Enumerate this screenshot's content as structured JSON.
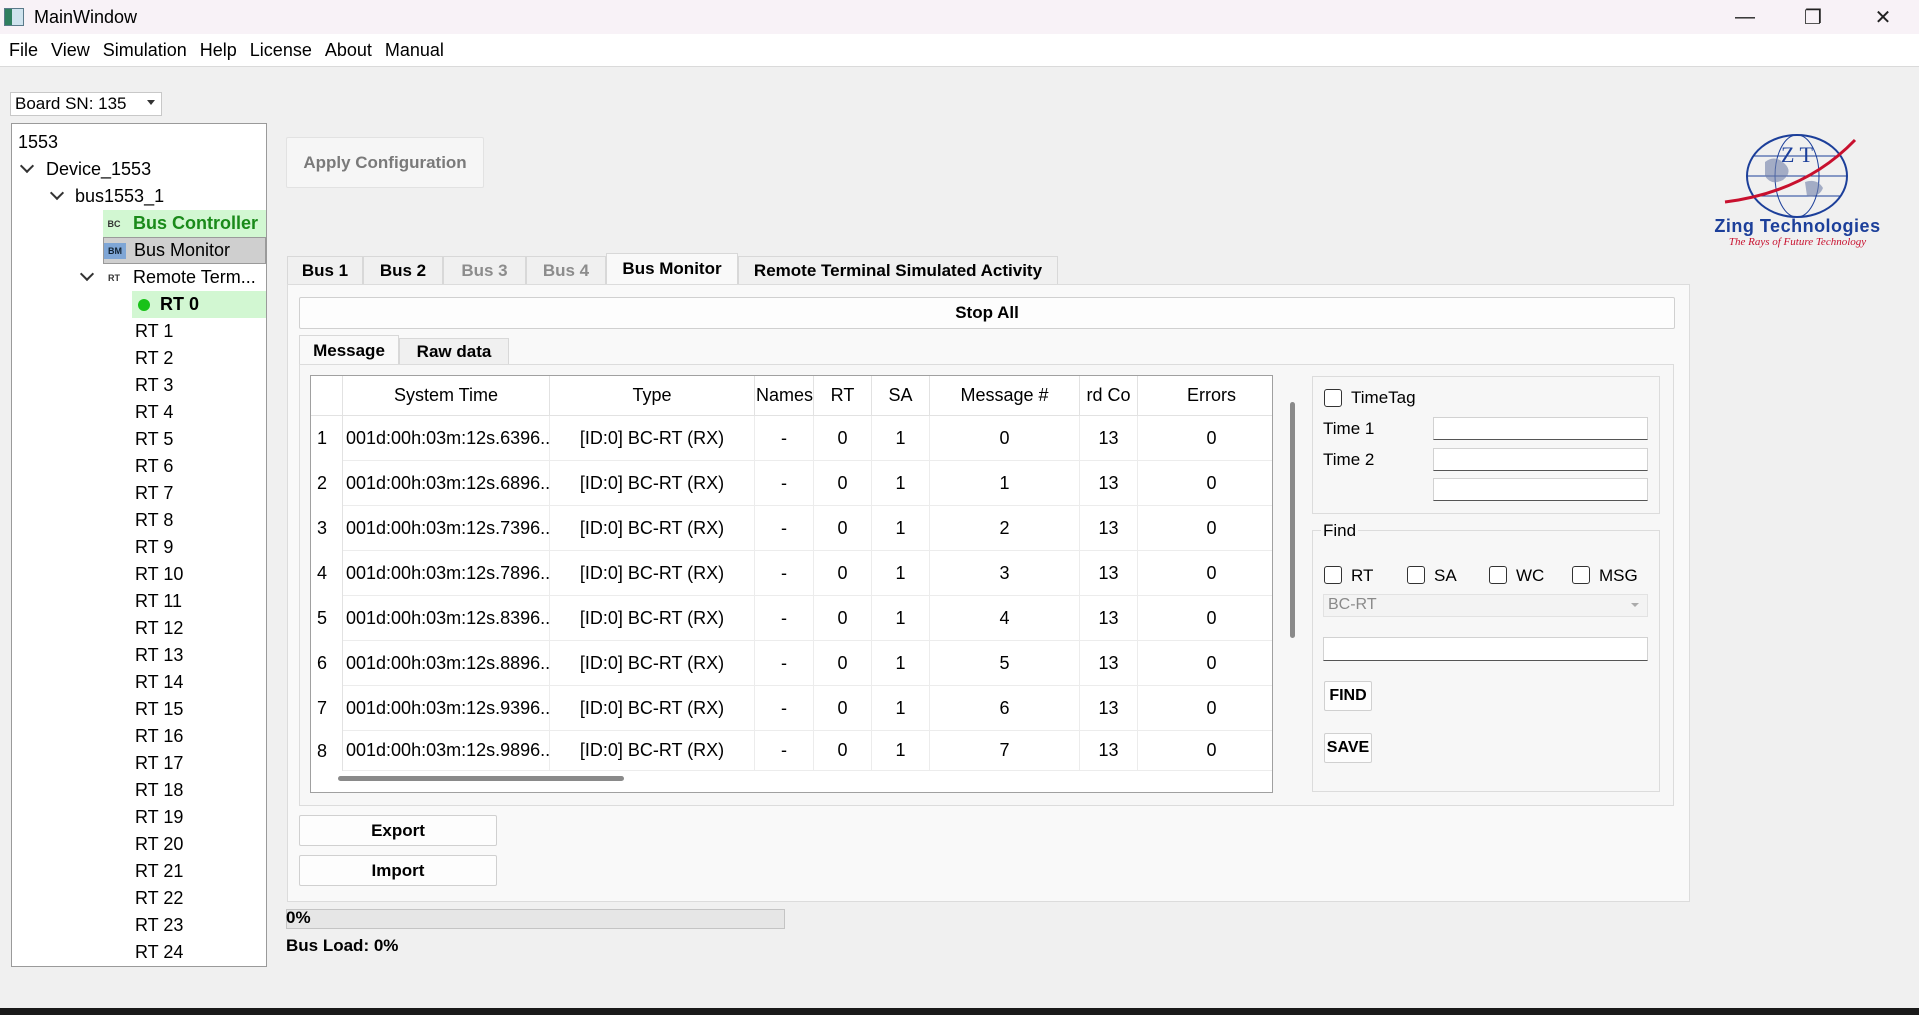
{
  "window": {
    "title": "MainWindow",
    "minimize_glyph": "—",
    "maximize_glyph": "❐",
    "close_glyph": "✕"
  },
  "menu": [
    "File",
    "View",
    "Simulation",
    "Help",
    "License",
    "About",
    "Manual"
  ],
  "board": {
    "label": "Board SN: 135"
  },
  "tree": {
    "root": "1553",
    "device": "Device_1553",
    "bus": "bus1553_1",
    "bc": {
      "tag": "BC",
      "label": "Bus Controller"
    },
    "bm": {
      "tag": "BM",
      "label": "Bus Monitor"
    },
    "rt": {
      "tag": "RT",
      "label": "Remote Term..."
    },
    "rt_items": [
      "RT 0",
      "RT 1",
      "RT 2",
      "RT 3",
      "RT 4",
      "RT 5",
      "RT 6",
      "RT 7",
      "RT 8",
      "RT 9",
      "RT 10",
      "RT 11",
      "RT 12",
      "RT 13",
      "RT 14",
      "RT 15",
      "RT 16",
      "RT 17",
      "RT 18",
      "RT 19",
      "RT 20",
      "RT 21",
      "RT 22",
      "RT 23",
      "RT 24"
    ]
  },
  "apply_button": "Apply Configuration",
  "logo": {
    "company": "Zing Technologies",
    "tagline": "The Rays of Future Technology",
    "mark": "Z T"
  },
  "tabs": [
    "Bus 1",
    "Bus 2",
    "Bus 3",
    "Bus 4",
    "Bus Monitor",
    "Remote Terminal Simulated Activity"
  ],
  "stop_all": "Stop All",
  "subtabs": [
    "Message",
    "Raw data"
  ],
  "table": {
    "headers": [
      "System Time",
      "Type",
      "Names",
      "RT",
      "SA",
      "Message #",
      "rd Co",
      "Errors"
    ],
    "rows": [
      {
        "num": "1",
        "cells": [
          "001d:00h:03m:12s.6396...",
          "[ID:0] BC-RT (RX)",
          "-",
          "0",
          "1",
          "0",
          "13",
          "0"
        ]
      },
      {
        "num": "2",
        "cells": [
          "001d:00h:03m:12s.6896...",
          "[ID:0] BC-RT (RX)",
          "-",
          "0",
          "1",
          "1",
          "13",
          "0"
        ]
      },
      {
        "num": "3",
        "cells": [
          "001d:00h:03m:12s.7396...",
          "[ID:0] BC-RT (RX)",
          "-",
          "0",
          "1",
          "2",
          "13",
          "0"
        ]
      },
      {
        "num": "4",
        "cells": [
          "001d:00h:03m:12s.7896...",
          "[ID:0] BC-RT (RX)",
          "-",
          "0",
          "1",
          "3",
          "13",
          "0"
        ]
      },
      {
        "num": "5",
        "cells": [
          "001d:00h:03m:12s.8396...",
          "[ID:0] BC-RT (RX)",
          "-",
          "0",
          "1",
          "4",
          "13",
          "0"
        ]
      },
      {
        "num": "6",
        "cells": [
          "001d:00h:03m:12s.8896...",
          "[ID:0] BC-RT (RX)",
          "-",
          "0",
          "1",
          "5",
          "13",
          "0"
        ]
      },
      {
        "num": "7",
        "cells": [
          "001d:00h:03m:12s.9396...",
          "[ID:0] BC-RT (RX)",
          "-",
          "0",
          "1",
          "6",
          "13",
          "0"
        ]
      },
      {
        "num": "8",
        "cells": [
          "001d:00h:03m:12s.9896...",
          "[ID:0] BC-RT (RX)",
          "-",
          "0",
          "1",
          "7",
          "13",
          "0"
        ]
      }
    ]
  },
  "timetag": {
    "label": "TimeTag",
    "time1": "Time 1",
    "time2": "Time 2",
    "time1_value": "",
    "time2_value": "",
    "time3_value": ""
  },
  "find": {
    "title": "Find",
    "checks": [
      "RT",
      "SA",
      "WC",
      "MSG"
    ],
    "type_value": "BC-RT",
    "search_value": "",
    "find_button": "FIND",
    "save_button": "SAVE"
  },
  "export_button": "Export",
  "import_button": "Import",
  "progress": {
    "text": "0%",
    "value": 0
  },
  "bus_load": "Bus Load: 0%",
  "colors": {
    "selected_green": "#d2f7d2",
    "selected_gray": "#cfcfcf",
    "dot_green": "#19c219",
    "logo_blue": "#1c3f9a",
    "logo_red": "#c8102e"
  }
}
